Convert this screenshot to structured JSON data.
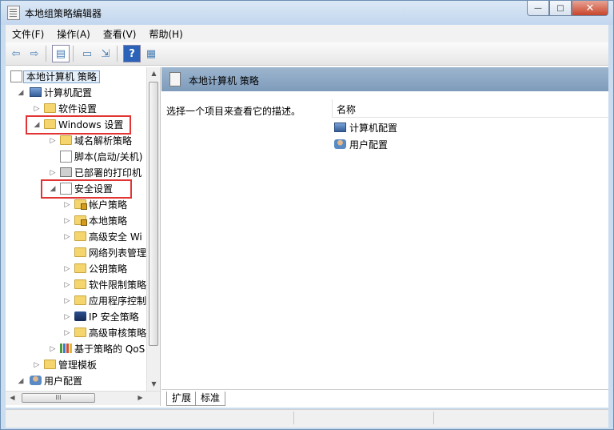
{
  "window": {
    "title": "本地组策略编辑器",
    "buttons": {
      "minimize": "—",
      "maximize": "□",
      "close": "✕"
    }
  },
  "menu": [
    "文件(F)",
    "操作(A)",
    "查看(V)",
    "帮助(H)"
  ],
  "tree": {
    "root": "本地计算机 策略",
    "items": [
      {
        "label": "计算机配置",
        "icon": "computer-icon"
      },
      {
        "label": "软件设置",
        "icon": "folder-icon"
      },
      {
        "label": "Windows 设置",
        "icon": "folder-icon"
      },
      {
        "label": "域名解析策略",
        "icon": "folder-icon"
      },
      {
        "label": "脚本(启动/关机)",
        "icon": "script-icon"
      },
      {
        "label": "已部署的打印机",
        "icon": "printer-icon"
      },
      {
        "label": "安全设置",
        "icon": "security-icon"
      },
      {
        "label": "帐户策略",
        "icon": "locked-folder-icon"
      },
      {
        "label": "本地策略",
        "icon": "locked-folder-icon"
      },
      {
        "label": "高级安全 Wi",
        "icon": "folder-icon"
      },
      {
        "label": "网络列表管理",
        "icon": "folder-icon"
      },
      {
        "label": "公钥策略",
        "icon": "folder-icon"
      },
      {
        "label": "软件限制策略",
        "icon": "folder-icon"
      },
      {
        "label": "应用程序控制",
        "icon": "folder-icon"
      },
      {
        "label": "IP 安全策略",
        "icon": "ipsec-icon"
      },
      {
        "label": "高级审核策略",
        "icon": "folder-icon"
      },
      {
        "label": "基于策略的 QoS",
        "icon": "chart-icon"
      },
      {
        "label": "管理模板",
        "icon": "folder-icon"
      },
      {
        "label": "用户配置",
        "icon": "user-icon"
      }
    ]
  },
  "right": {
    "header": "本地计算机 策略",
    "description": "选择一个项目来查看它的描述。",
    "column": "名称",
    "items": [
      "计算机配置",
      "用户配置"
    ],
    "tabs": [
      "扩展",
      "标准"
    ]
  },
  "scroll": {
    "hthumb_label": "III"
  },
  "colors": {
    "highlight": "#e23434",
    "header": "#8aa6c4"
  }
}
